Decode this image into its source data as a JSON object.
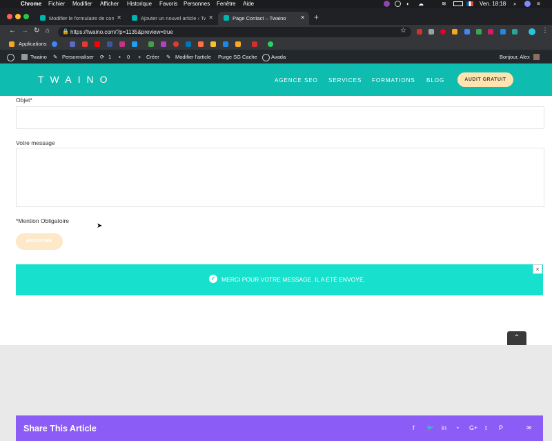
{
  "menubar": {
    "app": "Chrome",
    "items": [
      "Fichier",
      "Modifier",
      "Afficher",
      "Historique",
      "Favoris",
      "Personnes",
      "Fenêtre",
      "Aide"
    ],
    "clock": "Ven. 18:18"
  },
  "tabs": [
    {
      "label": "Modifier le formulaire de conta",
      "active": false
    },
    {
      "label": "Ajouter un nouvel article ‹ Twa",
      "active": false
    },
    {
      "label": "Page Contact – Twaino",
      "active": true
    }
  ],
  "address": {
    "url": "https://twaino.com/?p=1135&preview=true"
  },
  "bookmarks": {
    "label": "Applications"
  },
  "wpbar": {
    "site": "Twaino",
    "customize": "Personnaliser",
    "updates": "1",
    "comments": "0",
    "new": "Créer",
    "edit": "Modifier l'article",
    "purge": "Purge SG Cache",
    "avada": "Avada",
    "greeting": "Bonjour, Alex"
  },
  "site": {
    "logo": "TWAINO",
    "nav": [
      "AGENCE SEO",
      "SERVICES",
      "FORMATIONS",
      "BLOG"
    ],
    "cta": "AUDIT GRATUIT"
  },
  "form": {
    "subject_label": "Objet*",
    "message_label": "Votre message",
    "required_note": "*Mention Obligatoire",
    "submit": "ENVOYER",
    "success": "MERCI POUR VOTRE MESSAGE. IL A ÉTÉ ENVOYÉ."
  },
  "share": {
    "title": "Share This Article"
  },
  "colors": {
    "teal": "#0fbcb0",
    "success": "#17e0cd",
    "purple": "#8c5cf6",
    "cta": "#ffe4b0"
  }
}
